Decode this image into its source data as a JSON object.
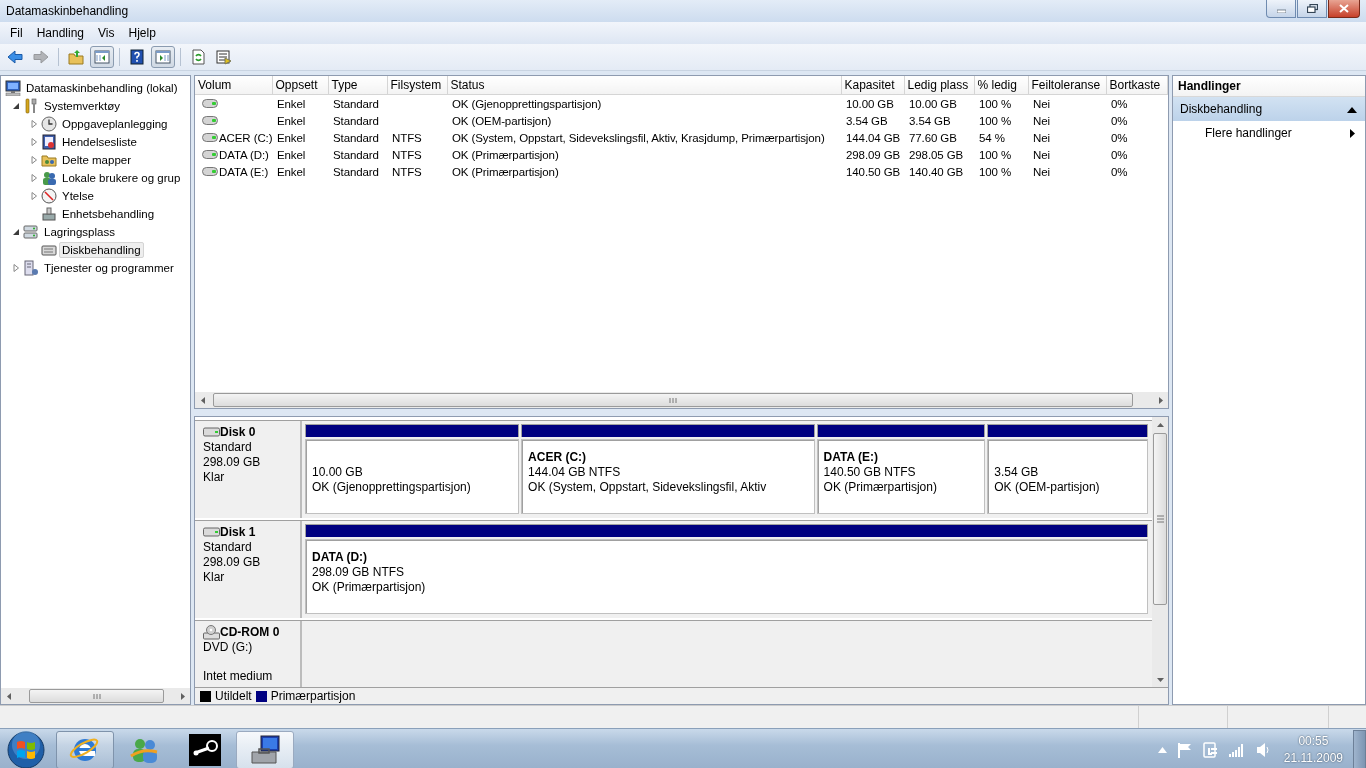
{
  "window": {
    "title": "Datamaskinbehandling"
  },
  "menu": [
    "Fil",
    "Handling",
    "Vis",
    "Hjelp"
  ],
  "toolbar": [
    {
      "kind": "back",
      "disabled": false,
      "pressed": false
    },
    {
      "kind": "forward",
      "disabled": true,
      "pressed": false
    },
    {
      "kind": "up",
      "disabled": false,
      "pressed": false
    },
    {
      "kind": "tree_toggle",
      "disabled": false,
      "pressed": true
    },
    {
      "kind": "help",
      "disabled": false,
      "pressed": false
    },
    {
      "kind": "action_toggle",
      "disabled": false,
      "pressed": true
    },
    {
      "kind": "refresh",
      "disabled": false,
      "pressed": false
    },
    {
      "kind": "export",
      "disabled": false,
      "pressed": false
    }
  ],
  "tree": [
    {
      "label": "Datamaskinbehandling (lokal)",
      "kind": "computer",
      "selected": false,
      "children": [
        {
          "label": "Systemverktøy",
          "kind": "tools",
          "selected": false,
          "expanded": true,
          "children": [
            {
              "label": "Oppgaveplanlegging",
              "kind": "clock",
              "selected": false,
              "expanded": false
            },
            {
              "label": "Hendelsesliste",
              "kind": "log",
              "selected": false,
              "expanded": false
            },
            {
              "label": "Delte mapper",
              "kind": "shared",
              "selected": false,
              "expanded": false
            },
            {
              "label": "Lokale brukere og grup",
              "kind": "users",
              "selected": false,
              "expanded": false
            },
            {
              "label": "Ytelse",
              "kind": "gauge",
              "selected": false,
              "expanded": false
            },
            {
              "label": "Enhetsbehandling",
              "kind": "device",
              "selected": false
            }
          ]
        },
        {
          "label": "Lagringsplass",
          "kind": "storage",
          "selected": false,
          "expanded": true,
          "children": [
            {
              "label": "Diskbehandling",
              "kind": "disk",
              "selected": true
            }
          ]
        },
        {
          "label": "Tjenester og programmer",
          "kind": "services",
          "selected": false,
          "expanded": false
        }
      ]
    }
  ],
  "table": {
    "columns": [
      "Volum",
      "Oppsett",
      "Type",
      "Filsystem",
      "Status",
      "Kapasitet",
      "Ledig plass",
      "% ledig",
      "Feiltoleranse",
      "Bortkaste"
    ],
    "rows": [
      {
        "layout": "Enkel",
        "type": "Standard",
        "status": "OK (Gjenopprettingspartisjon)",
        "capacity": "10.00 GB",
        "free_space": "10.00 GB",
        "percent_free": "100 %",
        "fault_tolerance": "Nei",
        "overhead": "0%"
      },
      {
        "layout": "Enkel",
        "type": "Standard",
        "status": "OK (OEM-partisjon)",
        "capacity": "3.54 GB",
        "free_space": "3.54 GB",
        "percent_free": "100 %",
        "fault_tolerance": "Nei",
        "overhead": "0%"
      },
      {
        "volume": "ACER (C:)",
        "layout": "Enkel",
        "type": "Standard",
        "filesystem": "NTFS",
        "status": "OK (System, Oppstart, Sidevekslingsfil, Aktiv, Krasjdump, Primærpartisjon)",
        "capacity": "144.04 GB",
        "free_space": "77.60 GB",
        "percent_free": "54 %",
        "fault_tolerance": "Nei",
        "overhead": "0%"
      },
      {
        "volume": "DATA (D:)",
        "layout": "Enkel",
        "type": "Standard",
        "filesystem": "NTFS",
        "status": "OK (Primærpartisjon)",
        "capacity": "298.09 GB",
        "free_space": "298.05 GB",
        "percent_free": "100 %",
        "fault_tolerance": "Nei",
        "overhead": "0%"
      },
      {
        "volume": "DATA (E:)",
        "layout": "Enkel",
        "type": "Standard",
        "filesystem": "NTFS",
        "status": "OK (Primærpartisjon)",
        "capacity": "140.50 GB",
        "free_space": "140.40 GB",
        "percent_free": "100 %",
        "fault_tolerance": "Nei",
        "overhead": "0%"
      }
    ]
  },
  "disks": [
    {
      "kind": "disk",
      "name": "Disk 0",
      "details": [
        "Standard",
        "298.09 GB",
        "Klar"
      ],
      "partitions": [
        {
          "size": "10.00 GB",
          "status": "OK (Gjenopprettingspartisjon)",
          "color": "#000080"
        },
        {
          "label": "ACER (C:)",
          "size": "144.04 GB NTFS",
          "status": "OK (System, Oppstart, Sidevekslingsfil, Aktiv",
          "color": "#000080"
        },
        {
          "label": "DATA (E:)",
          "size": "140.50 GB NTFS",
          "status": "OK (Primærpartisjon)",
          "color": "#000080"
        },
        {
          "size": "3.54 GB",
          "status": "OK (OEM-partisjon)",
          "color": "#000080"
        }
      ]
    },
    {
      "kind": "disk",
      "name": "Disk 1",
      "details": [
        "Standard",
        "298.09 GB",
        "Klar"
      ],
      "partitions": [
        {
          "label": "DATA (D:)",
          "size": "298.09 GB NTFS",
          "status": "OK (Primærpartisjon)",
          "color": "#000080"
        }
      ]
    },
    {
      "kind": "cdrom",
      "name": "CD-ROM 0",
      "details": [
        "DVD (G:)"
      ],
      "media": "Intet medium"
    }
  ],
  "legend": [
    {
      "label": "Utildelt",
      "color": "#000000"
    },
    {
      "label": "Primærpartisjon",
      "color": "#000080"
    }
  ],
  "actions": {
    "title": "Handlinger",
    "sections": [
      {
        "label": "Diskbehandling",
        "expanded": true,
        "items": [
          "Flere handlinger"
        ]
      }
    ]
  },
  "taskbar": {
    "apps": [
      {
        "kind": "browser",
        "running": true,
        "selected": false
      },
      {
        "kind": "contacts",
        "running": false,
        "selected": false
      },
      {
        "kind": "game_client",
        "running": false,
        "selected": false
      },
      {
        "kind": "management",
        "running": true,
        "selected": true
      }
    ],
    "clock": {
      "time": "00:55",
      "date": "21.11.2009"
    }
  }
}
